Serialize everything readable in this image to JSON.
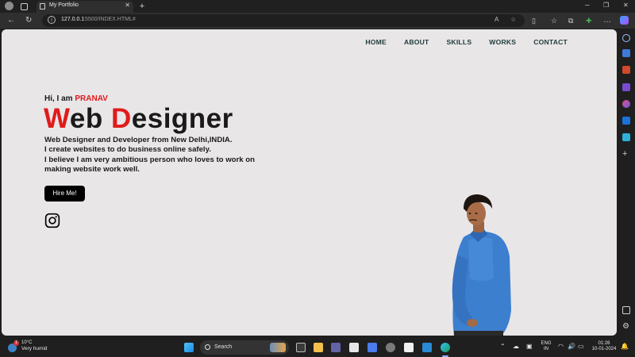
{
  "browser": {
    "tab_title": "My Portfolio",
    "url_host": "127.0.0.1",
    "url_path": ":5500/INDEX.HTML#"
  },
  "site": {
    "nav": [
      "HOME",
      "ABOUT",
      "SKILLS",
      "WORKS",
      "CONTACT"
    ],
    "greeting_prefix": "Hi, I am ",
    "greeting_name": "PRANAV",
    "headline_w": "W",
    "headline_eb": "eb ",
    "headline_d": "D",
    "headline_esigner": "esigner",
    "desc_lines": [
      "Web Designer and Developer from New Delhi,INDIA.",
      "I create websites to do business online safely.",
      "I believe I am very ambitious person who loves to work on",
      "making website work well."
    ],
    "hire_button": "Hire Me!",
    "accent_color": "#e01b1b"
  },
  "taskbar": {
    "weather_temp": "10°C",
    "weather_cond": "Very humid",
    "weather_badge": "1",
    "search_placeholder": "Search",
    "lang_top": "ENG",
    "lang_bottom": "IN",
    "time": "01:26",
    "date": "10-01-2024"
  }
}
